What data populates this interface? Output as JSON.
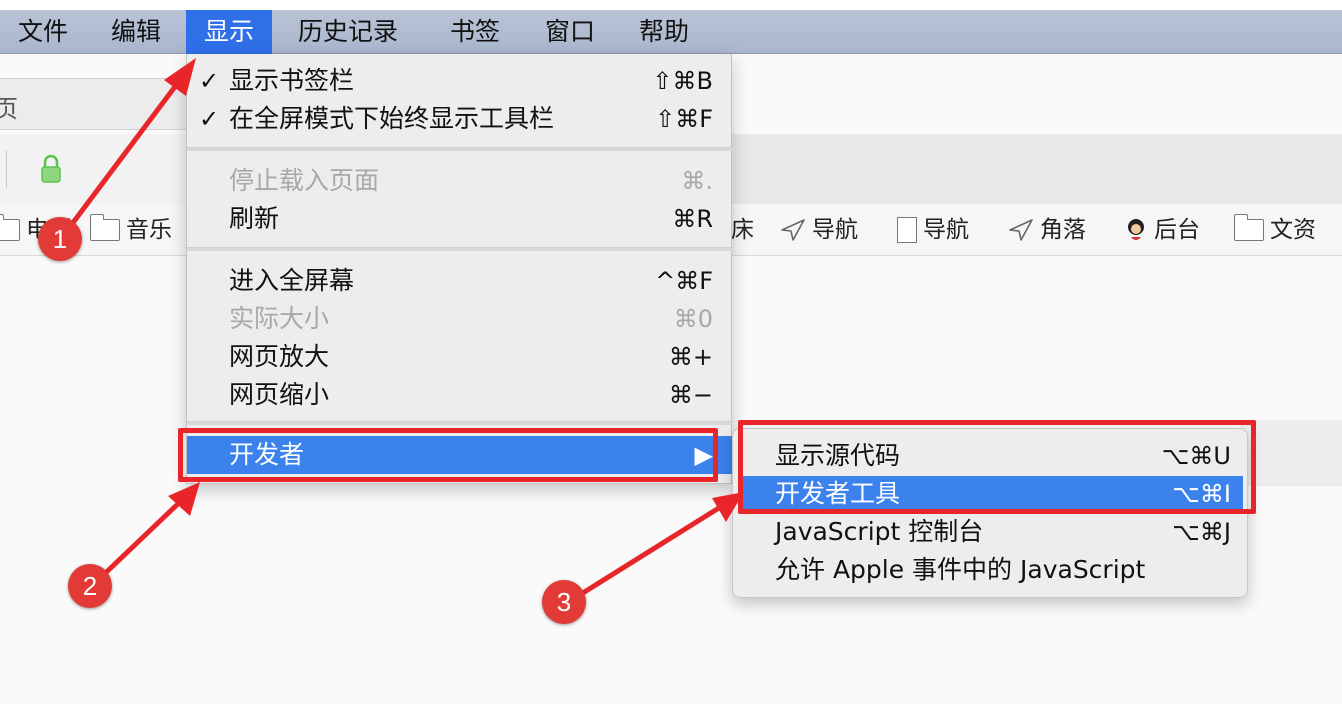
{
  "menubar": {
    "items": [
      "文件",
      "编辑",
      "显示",
      "历史记录",
      "书签",
      "窗口",
      "帮助"
    ],
    "active_index": 2
  },
  "background": {
    "address_fragment": "页",
    "bookmarks": [
      {
        "icon": "folder-icon",
        "label": "电影"
      },
      {
        "icon": "folder-icon",
        "label": "音乐"
      },
      {
        "icon": "none",
        "label": "床"
      },
      {
        "icon": "navigation-arrow-icon",
        "label": "导航"
      },
      {
        "icon": "document-icon",
        "label": "导航"
      },
      {
        "icon": "navigation-arrow-icon",
        "label": "角落"
      },
      {
        "icon": "avatar-icon",
        "label": "后台"
      },
      {
        "icon": "folder-icon",
        "label": "文资"
      }
    ]
  },
  "view_menu": {
    "items": [
      {
        "label": "显示书签栏",
        "shortcut": "⇧⌘B",
        "checked": "✓"
      },
      {
        "label": "在全屏模式下始终显示工具栏",
        "shortcut": "⇧⌘F",
        "checked": "✓"
      },
      {
        "label": "停止载入页面",
        "shortcut": "⌘.",
        "disabled": true
      },
      {
        "label": "刷新",
        "shortcut": "⌘R"
      },
      {
        "label": "进入全屏幕",
        "shortcut": "^⌘F"
      },
      {
        "label": "实际大小",
        "shortcut": "⌘0",
        "disabled": true
      },
      {
        "label": "网页放大",
        "shortcut": "⌘+"
      },
      {
        "label": "网页缩小",
        "shortcut": "⌘−"
      },
      {
        "label": "开发者",
        "shortcut": "▶",
        "highlighted": true
      }
    ]
  },
  "developer_submenu": {
    "items": [
      {
        "label": "显示源代码",
        "shortcut": "⌥⌘U"
      },
      {
        "label": "开发者工具",
        "shortcut": "⌥⌘I",
        "highlighted": true
      },
      {
        "label": "JavaScript 控制台",
        "shortcut": "⌥⌘J"
      },
      {
        "label": "允许 Apple 事件中的 JavaScript",
        "shortcut": ""
      }
    ]
  },
  "annotations": {
    "steps": [
      "1",
      "2",
      "3"
    ],
    "color": "#e8262a"
  },
  "colors": {
    "highlight": "#3b82ec",
    "menubar_active": "#2f6fe8"
  }
}
